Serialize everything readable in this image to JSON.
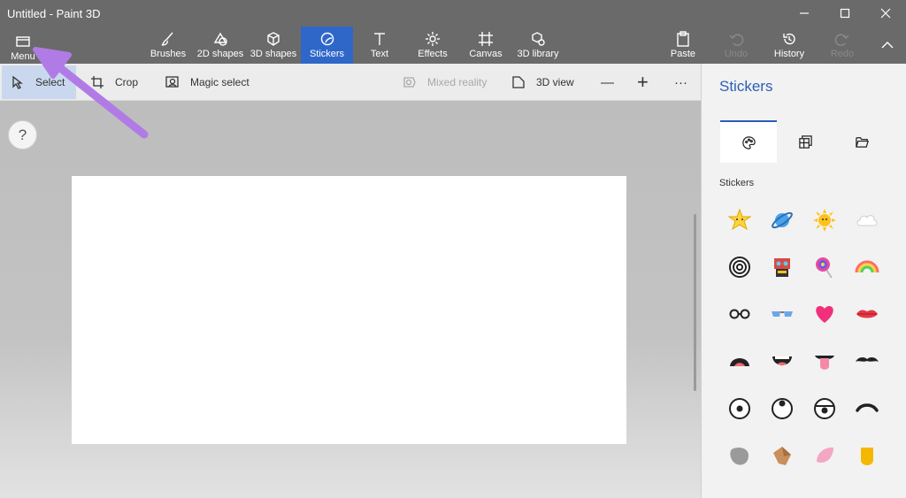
{
  "window": {
    "title": "Untitled - Paint 3D"
  },
  "ribbon": {
    "menu": "Menu",
    "brushes": "Brushes",
    "shapes2d": "2D shapes",
    "shapes3d": "3D shapes",
    "stickers": "Stickers",
    "text": "Text",
    "effects": "Effects",
    "canvas": "Canvas",
    "library3d": "3D library",
    "paste": "Paste",
    "undo": "Undo",
    "history": "History",
    "redo": "Redo"
  },
  "toolbar": {
    "select": "Select",
    "crop": "Crop",
    "magic_select": "Magic select",
    "mixed_reality": "Mixed reality",
    "view3d": "3D view",
    "zoom_out": "—",
    "zoom_in": "+",
    "more": "···"
  },
  "help": {
    "label": "?"
  },
  "panel": {
    "title": "Stickers",
    "section": "Stickers"
  },
  "colors": {
    "accent": "#2f67c9",
    "ribbon": "#6a6a6a",
    "annotation": "#b17be6"
  },
  "stickers": [
    "star-sticker",
    "planet-sticker",
    "sun-sticker",
    "cloud-sticker",
    "spiral-sticker",
    "robot-sticker",
    "lollipop-sticker",
    "rainbow-sticker",
    "glasses-sticker",
    "sunglasses-sticker",
    "heart-sticker",
    "lips-sticker",
    "open-mouth-sticker",
    "smile-mouth-sticker",
    "tongue-sticker",
    "mustache-sticker",
    "eye-sticker",
    "eye-up-sticker",
    "eye-lid-sticker",
    "eyebrow-sticker",
    "gray-texture-sticker",
    "wood-texture-sticker",
    "pink-texture-sticker",
    "yellow-texture-sticker"
  ]
}
